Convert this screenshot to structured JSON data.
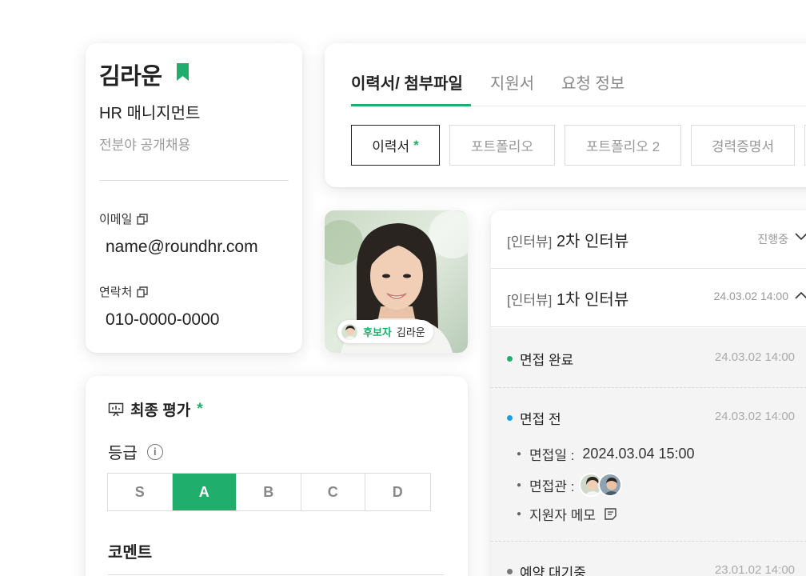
{
  "profile": {
    "name": "김라운",
    "department": "HR 매니지먼트",
    "recruit_type": "전분야 공개채용",
    "email_label": "이메일",
    "email": "name@roundhr.com",
    "phone_label": "연락처",
    "phone": "010-0000-0000"
  },
  "tabs": {
    "items": [
      "이력서/ 첨부파일",
      "지원서",
      "요청 정보"
    ],
    "active_index": 0,
    "documents": [
      {
        "label": "이력서",
        "required": "*"
      },
      {
        "label": "포트폴리오"
      },
      {
        "label": "포트폴리오 2"
      },
      {
        "label": "경력증명서"
      }
    ]
  },
  "candidate": {
    "tag": "후보자",
    "name": "김라운"
  },
  "evaluation": {
    "title": "최종 평가",
    "required": "*",
    "grade_label": "등급",
    "info_icon": "i",
    "grades": [
      "S",
      "A",
      "B",
      "C",
      "D"
    ],
    "selected_grade": "A",
    "comment_label": "코멘트"
  },
  "interviews": [
    {
      "bracket": "[인터뷰]",
      "title": "2차 인터뷰",
      "meta": "진행중",
      "expanded": false
    },
    {
      "bracket": "[인터뷰]",
      "title": "1차 인터뷰",
      "meta": "24.03.02 14:00",
      "expanded": true
    }
  ],
  "interview_detail": {
    "statuses": [
      {
        "label": "면접 완료",
        "time": "24.03.02 14:00",
        "color": "#1fae6b"
      },
      {
        "label": "면접 전",
        "time": "24.03.02 14:00",
        "color": "#1a9ee6"
      },
      {
        "label": "예약 대기중",
        "time": "23.01.02 14:00",
        "color": "#777777"
      }
    ],
    "date_label": "면접일 :",
    "date_value": "2024.03.04 15:00",
    "interviewer_label": "면접관 :",
    "memo_label": "지원자 메모"
  },
  "colors": {
    "accent": "#1fae6b",
    "blue": "#1a9ee6"
  }
}
